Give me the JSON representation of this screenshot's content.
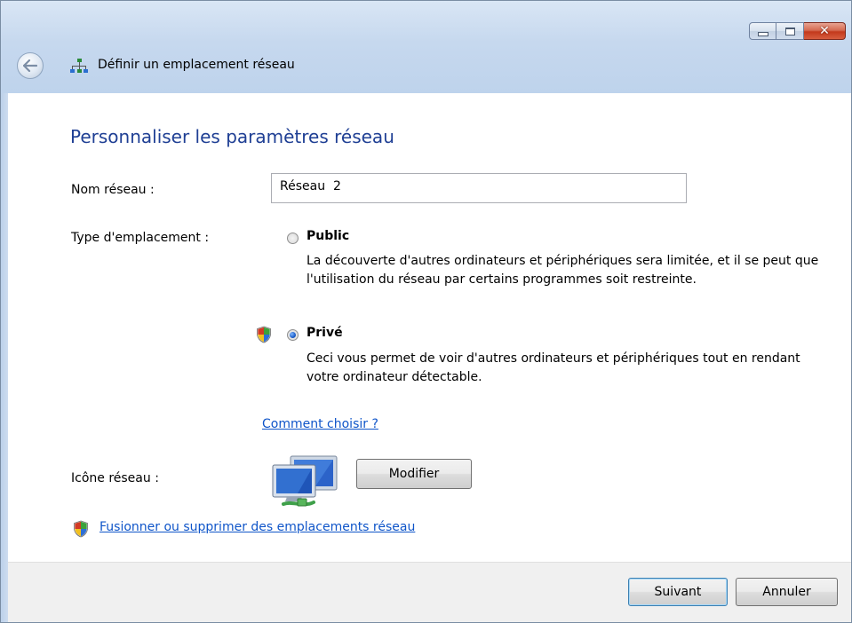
{
  "window": {
    "title": "Définir un emplacement réseau",
    "buttons": {
      "minimize": "minimize-icon",
      "maximize": "maximize-icon",
      "close": "close-icon"
    }
  },
  "main": {
    "heading": "Personnaliser les paramètres réseau",
    "network_name_label": "Nom réseau :",
    "network_name_value": "Réseau  2",
    "location_type_label": "Type d'emplacement :",
    "options": [
      {
        "title": "Public",
        "description": "La découverte d'autres ordinateurs et périphériques sera limitée, et il se peut que l'utilisation du réseau par certains programmes soit restreinte.",
        "selected": false
      },
      {
        "title": "Privé",
        "description": "Ceci vous permet de voir d'autres ordinateurs et périphériques tout en rendant votre ordinateur détectable.",
        "selected": true
      }
    ],
    "help_link": "Comment choisir ?",
    "network_icon_label": "Icône réseau :",
    "modify_button": "Modifier",
    "merge_link": "Fusionner ou supprimer des emplacements réseau"
  },
  "footer": {
    "next_button": "Suivant",
    "cancel_button": "Annuler"
  },
  "colors": {
    "heading": "#1f3f94",
    "link": "#0f55c9",
    "frame": "#c6d8ee",
    "footer": "#f0f0f0"
  }
}
